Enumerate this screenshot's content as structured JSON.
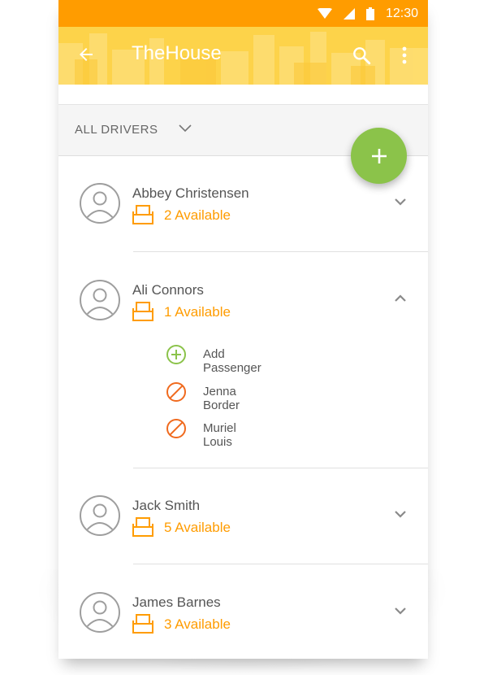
{
  "status_bar": {
    "time": "12:30"
  },
  "app_bar": {
    "title": "TheHouse"
  },
  "filter": {
    "label": "ALL DRIVERS"
  },
  "drivers": [
    {
      "name": "Abbey Christensen",
      "availability": "2 Available",
      "expanded": false
    },
    {
      "name": "Ali Connors",
      "availability": "1 Available",
      "expanded": true,
      "sub_items": [
        {
          "label": "Add Passenger",
          "icon": "add-circle-icon"
        },
        {
          "label": "Jenna Border",
          "icon": "block-icon"
        },
        {
          "label": "Muriel Louis",
          "icon": "block-icon"
        }
      ]
    },
    {
      "name": "Jack Smith",
      "availability": "5 Available",
      "expanded": false
    },
    {
      "name": "James Barnes",
      "availability": "3 Available",
      "expanded": false
    }
  ],
  "colors": {
    "status_bar": "#ff9c00",
    "app_bar": "#fdd34a",
    "accent_orange": "#ff9c00",
    "fab_green": "#8bc34a",
    "blocked_orange": "#f06a1e"
  }
}
